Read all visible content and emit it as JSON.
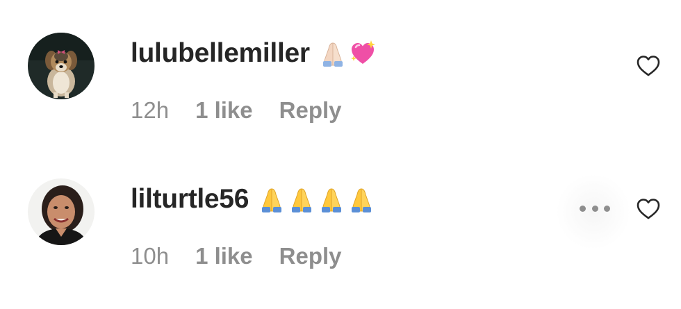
{
  "comments": [
    {
      "username": "lulubellemiller",
      "emojis": [
        "folded-hands-light-skin",
        "sparkling-heart"
      ],
      "time": "12h",
      "likes": "1 like",
      "reply_label": "Reply",
      "avatar": "yorkshire-terrier-dog-photo",
      "liked": false
    },
    {
      "username": "lilturtle56",
      "emojis": [
        "folded-hands",
        "folded-hands",
        "folded-hands",
        "folded-hands"
      ],
      "time": "10h",
      "likes": "1 like",
      "reply_label": "Reply",
      "avatar": "smiling-woman-photo",
      "liked": false,
      "more_options_visible": true
    }
  ],
  "colors": {
    "username": "#262626",
    "meta": "#8e8e8e",
    "heart_outline": "#262626"
  }
}
